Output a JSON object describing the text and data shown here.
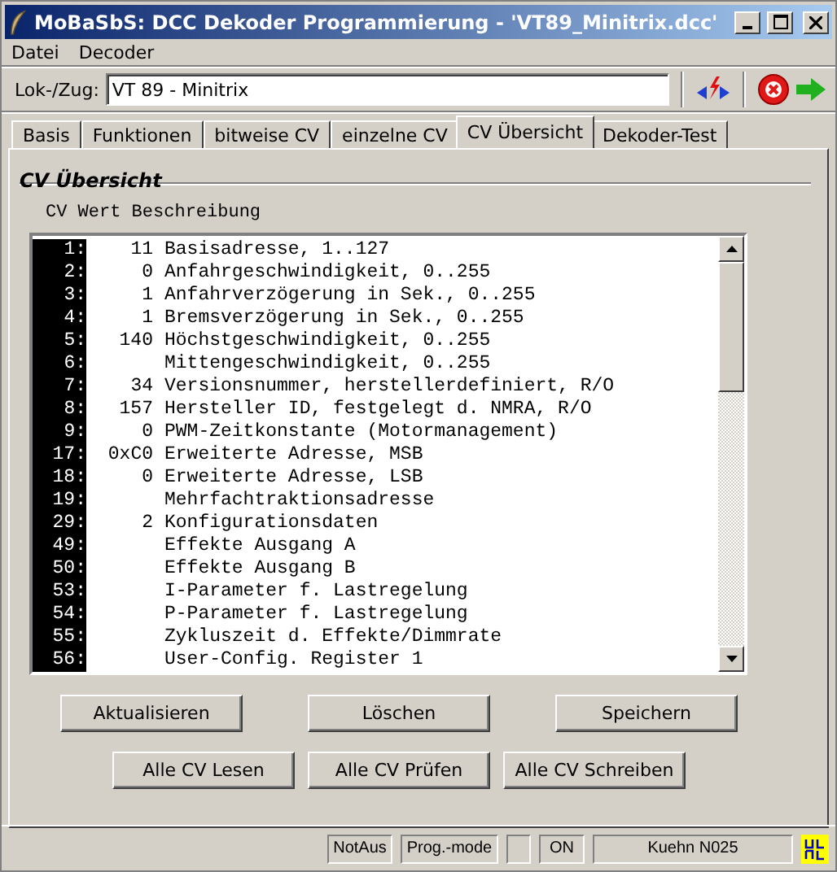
{
  "window": {
    "title": "MoBaSbS: DCC Dekoder Programmierung  -  'VT89_Minitrix.dcc'"
  },
  "menu": [
    "Datei",
    "Decoder"
  ],
  "toolbar": {
    "label": "Lok-/Zug:",
    "value": "VT 89 - Minitrix"
  },
  "tabs": [
    {
      "label": "Basis",
      "selected": false
    },
    {
      "label": "Funktionen",
      "selected": false
    },
    {
      "label": "bitweise CV",
      "selected": false
    },
    {
      "label": "einzelne CV",
      "selected": false
    },
    {
      "label": "CV Übersicht",
      "selected": true
    },
    {
      "label": "Dekoder-Test",
      "selected": false
    }
  ],
  "group": {
    "title": "CV Übersicht",
    "header": "CV Wert Beschreibung"
  },
  "rows": [
    {
      "cv": "1:",
      "value": "11",
      "description": "Basisadresse, 1..127"
    },
    {
      "cv": "2:",
      "value": "0",
      "description": "Anfahrgeschwindigkeit, 0..255"
    },
    {
      "cv": "3:",
      "value": "1",
      "description": "Anfahrverzögerung in Sek., 0..255"
    },
    {
      "cv": "4:",
      "value": "1",
      "description": "Bremsverzögerung in Sek., 0..255"
    },
    {
      "cv": "5:",
      "value": "140",
      "description": "Höchstgeschwindigkeit, 0..255"
    },
    {
      "cv": "6:",
      "description": "Mittengeschwindigkeit, 0..255"
    },
    {
      "cv": "7:",
      "value": "34",
      "description": "Versionsnummer, herstellerdefiniert, R/O"
    },
    {
      "cv": "8:",
      "value": "157",
      "description": "Hersteller ID, festgelegt d. NMRA, R/O"
    },
    {
      "cv": "9:",
      "value": "0",
      "description": "PWM-Zeitkonstante (Motormanagement)"
    },
    {
      "cv": "17:",
      "value": "0xC0",
      "description": "Erweiterte Adresse, MSB"
    },
    {
      "cv": "18:",
      "value": "0",
      "description": "Erweiterte Adresse, LSB"
    },
    {
      "cv": "19:",
      "description": "Mehrfachtraktionsadresse"
    },
    {
      "cv": "29:",
      "value": "2",
      "description": "Konfigurationsdaten"
    },
    {
      "cv": "49:",
      "description": "Effekte Ausgang A"
    },
    {
      "cv": "50:",
      "description": "Effekte Ausgang B"
    },
    {
      "cv": "53:",
      "description": "I-Parameter f. Lastregelung"
    },
    {
      "cv": "54:",
      "description": "P-Parameter f. Lastregelung"
    },
    {
      "cv": "55:",
      "description": "Zykluszeit d. Effekte/Dimmrate"
    },
    {
      "cv": "56:",
      "description": "User-Config. Register 1"
    }
  ],
  "buttons_row_1": [
    "Aktualisieren",
    "Löschen",
    "Speichern"
  ],
  "buttons_row_2": [
    "Alle CV Lesen",
    "Alle CV Prüfen",
    "Alle CV Schreiben"
  ],
  "status_bar": [
    "NotAus",
    "Prog.-mode",
    "ON",
    "Kuehn N025"
  ]
}
